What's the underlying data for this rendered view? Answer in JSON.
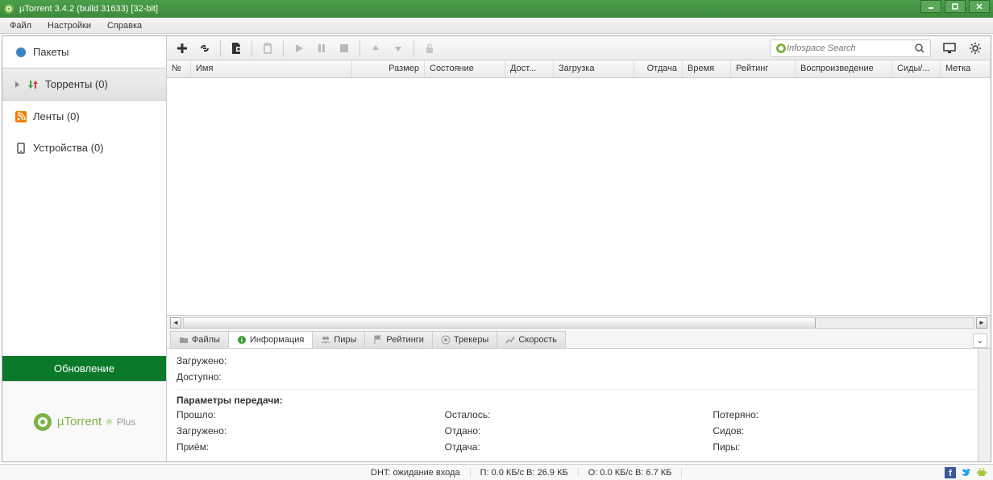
{
  "window": {
    "title": "µTorrent 3.4.2  (build 31633) [32-bit]"
  },
  "menu": [
    "Файл",
    "Настройки",
    "Справка"
  ],
  "sidebar": {
    "items": [
      {
        "label": "Пакеты",
        "count": ""
      },
      {
        "label": "Торренты (0)",
        "count": ""
      },
      {
        "label": "Ленты (0)",
        "count": ""
      },
      {
        "label": "Устройства (0)",
        "count": ""
      }
    ],
    "update": "Обновление",
    "plus_brand": "µTorrent",
    "plus_suffix": "Plus"
  },
  "search": {
    "placeholder": "Infospace Search"
  },
  "columns": [
    "№",
    "Имя",
    "Размер",
    "Состояние",
    "Дост...",
    "Загрузка",
    "Отдача",
    "Время",
    "Рейтинг",
    "Воспроизведение",
    "Сиды/...",
    "Метка"
  ],
  "tabs": [
    "Файлы",
    "Информация",
    "Пиры",
    "Рейтинги",
    "Трекеры",
    "Скорость"
  ],
  "info": {
    "downloaded": "Загружено:",
    "available": "Доступно:",
    "section": "Параметры передачи:",
    "col1": [
      "Прошло:",
      "Загружено:",
      "Приём:"
    ],
    "col2": [
      "Осталось:",
      "Отдано:",
      "Отдача:"
    ],
    "col3": [
      "Потеряно:",
      "Сидов:",
      "Пиры:"
    ]
  },
  "status": {
    "dht": "DHT: ожидание входа",
    "down": "П: 0.0 КБ/с В: 26.9 КБ",
    "up": "О: 0.0 КБ/с В: 6.7 КБ"
  }
}
